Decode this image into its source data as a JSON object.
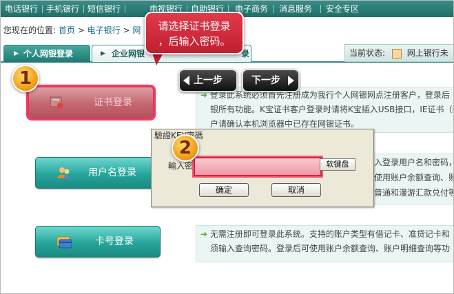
{
  "nav": {
    "items": [
      "电话银行",
      "手机银行",
      "短信银行",
      "电视银行",
      "自助银行",
      "电子商务",
      "消息服务",
      "安全专区"
    ]
  },
  "breadcrumb": {
    "prefix": "您现在的位置:",
    "home": "首页",
    "sep": ">",
    "section": "电子银行",
    "current": "网"
  },
  "tabs": {
    "personal": "个人网银登录",
    "enterprise": "企业网银",
    "third_partial": "录"
  },
  "status": {
    "label": "当前状态:",
    "value": "网上银行未"
  },
  "callout": {
    "line1": "请选择证书登录",
    "line2": "，后输入密码。"
  },
  "steps": {
    "prev": "上一步",
    "next": "下一步",
    "marker1": "1",
    "marker2": "2"
  },
  "login_buttons": {
    "cert": "证书登录",
    "username": "用户名登录",
    "card": "卡号登录"
  },
  "panels": {
    "cert_line1": "登录此系统必须首先注册成为我行个人网银网点注册客户，登录后",
    "cert_line2": "银所有功能。K宝证书客户登录时请将K宝插入USB接口，IE证书（纠",
    "cert_line3": "户请确认本机浏览器中已存在网银证书。",
    "user_line1": "入登录用户名和密码，",
    "user_line2": "使用账户余额查询、账户",
    "user_line3": "普通和漫游汇款兑付等",
    "card_line1": "无需注册即可登录此系统。支持的账户类型有借记卡、准贷记卡和",
    "card_line2": "须输入查询密码。登录后可使用账户余额查询、账户明细查询等功"
  },
  "dialog": {
    "title": "驗證KEY密碼",
    "label": "輸入密碼:",
    "soft_keyboard": "软键盘",
    "ok": "确定",
    "cancel": "取消"
  },
  "colors": {
    "nav_bg": "#1f6e68",
    "accent_red": "#e0203c",
    "teal_button": "#26a59b"
  }
}
